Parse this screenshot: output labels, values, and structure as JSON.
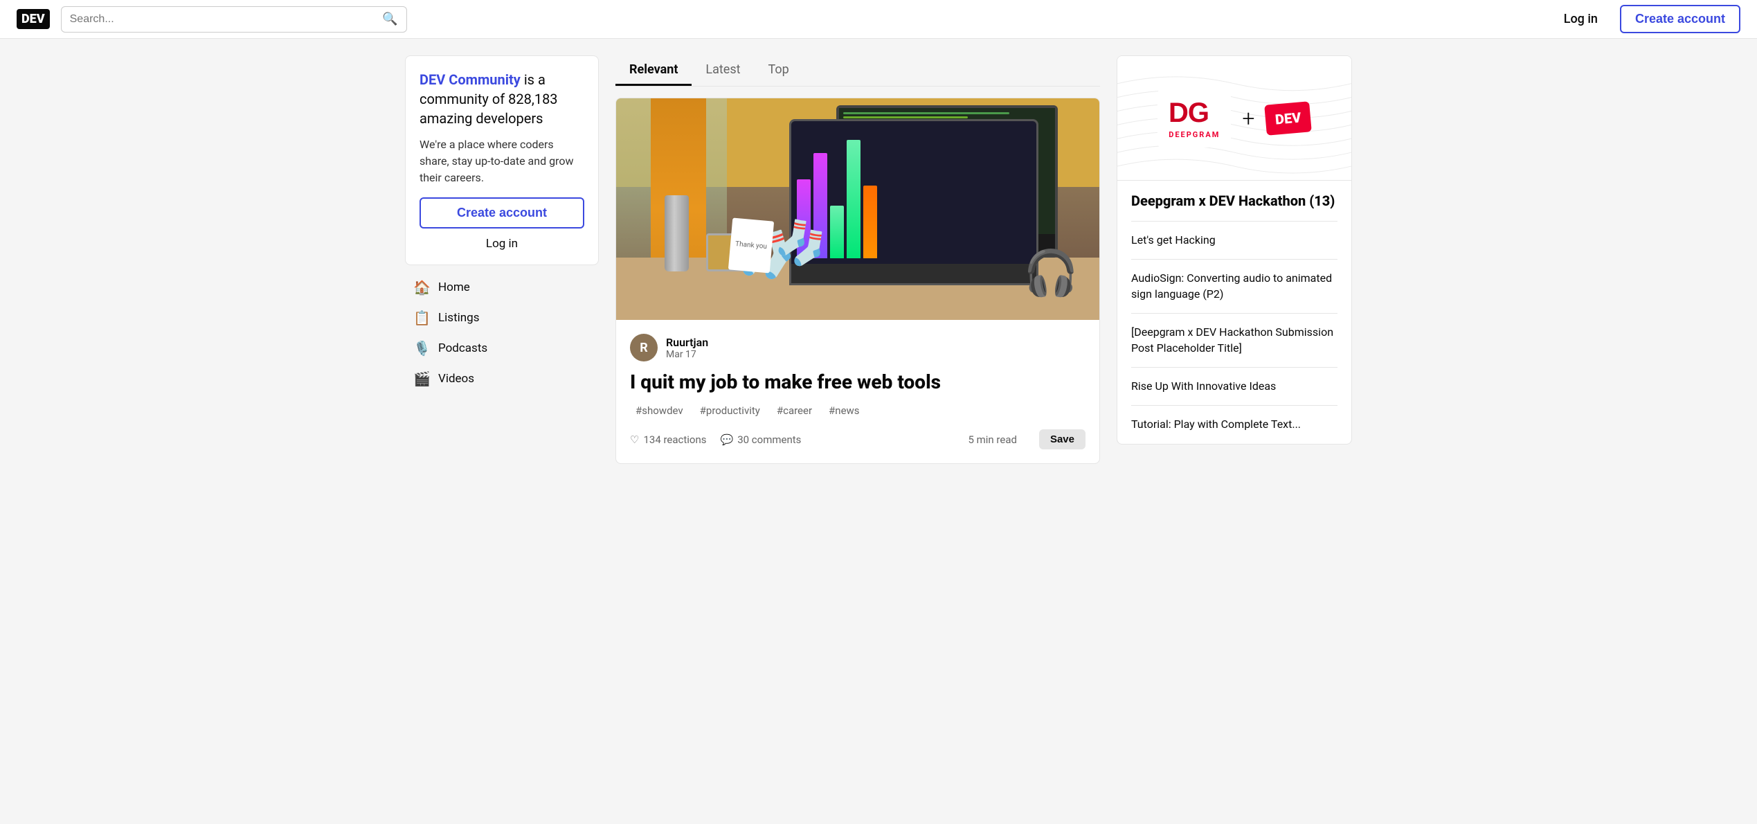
{
  "header": {
    "logo": "DEV",
    "search_placeholder": "Search...",
    "login_label": "Log in",
    "create_account_label": "Create account"
  },
  "sidebar": {
    "tagline_brand": "DEV Community",
    "tagline_rest": " is a community of 828,183 amazing developers",
    "description": "We're a place where coders share, stay up-to-date and grow their careers.",
    "create_account_btn": "Create account",
    "login_label": "Log in",
    "nav_items": [
      {
        "icon": "🏠",
        "label": "Home",
        "id": "home"
      },
      {
        "icon": "📋",
        "label": "Listings",
        "id": "listings"
      },
      {
        "icon": "🎙️",
        "label": "Podcasts",
        "id": "podcasts"
      },
      {
        "icon": "🎬",
        "label": "Videos",
        "id": "videos"
      }
    ]
  },
  "feed": {
    "tabs": [
      {
        "label": "Relevant",
        "active": true
      },
      {
        "label": "Latest",
        "active": false
      },
      {
        "label": "Top",
        "active": false
      }
    ],
    "article": {
      "author_name": "Ruurtjan",
      "author_date": "Mar 17",
      "author_initial": "R",
      "title": "I quit my job to make free web tools",
      "tags": [
        "#showdev",
        "#productivity",
        "#career",
        "#news"
      ],
      "reactions_count": "134 reactions",
      "comments_count": "30 comments",
      "read_time": "5 min read",
      "save_label": "Save"
    }
  },
  "right_sidebar": {
    "hackathon_title": "Deepgram x DEV Hackathon (13)",
    "deepgram_label": "DG",
    "deepgram_sub": "DEEPGRAM",
    "dev_label": "DEV",
    "plus": "+",
    "lets_get_hacking": "Let's get Hacking",
    "link1": "AudioSign: Converting audio to animated sign language (P2)",
    "link2": "[Deepgram x DEV Hackathon Submission Post Placeholder Title]",
    "link3": "Rise Up With Innovative Ideas",
    "link4": "Tutorial: Play with Complete Text..."
  }
}
